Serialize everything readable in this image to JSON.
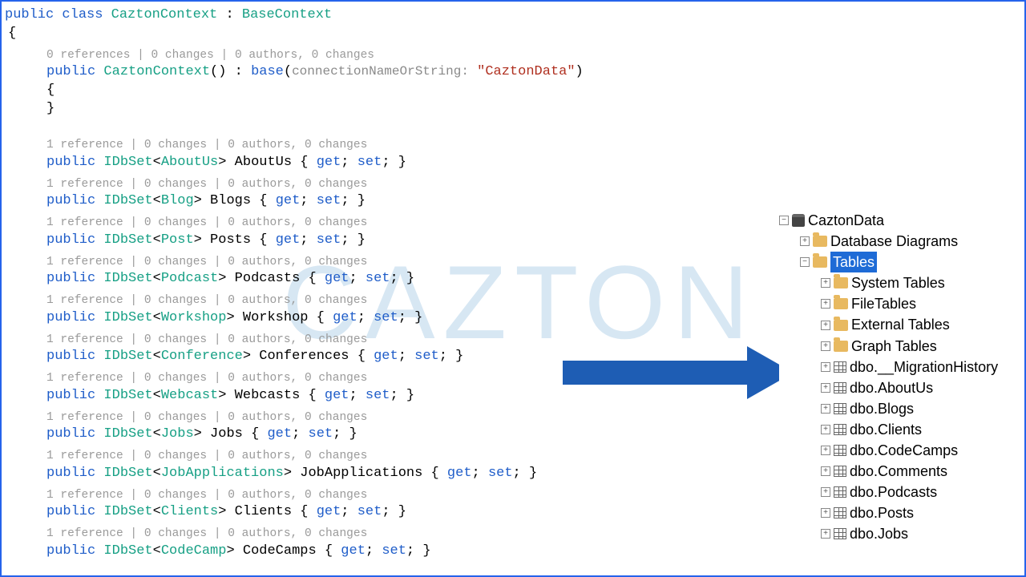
{
  "watermark": "CAZTON",
  "classDecl": {
    "kw1": "public",
    "kw2": "class",
    "name": "CaztonContext",
    "colon": ":",
    "base": "BaseContext"
  },
  "ctor": {
    "lens": "0 references | 0 changes | 0 authors, 0 changes",
    "kw": "public",
    "name": "CaztonContext",
    "parens": "()",
    "colon": ":",
    "baseKw": "base",
    "open": "(",
    "hint": "connectionNameOrString:",
    "str": "\"CaztonData\"",
    "close": ")",
    "braceOpen": "{",
    "braceClose": "}"
  },
  "openBrace": "{",
  "propLens": "1 reference | 0 changes | 0 authors, 0 changes",
  "props": [
    {
      "type": "AboutUs",
      "name": "AboutUs"
    },
    {
      "type": "Blog",
      "name": "Blogs"
    },
    {
      "type": "Post",
      "name": "Posts"
    },
    {
      "type": "Podcast",
      "name": "Podcasts"
    },
    {
      "type": "Workshop",
      "name": "Workshop"
    },
    {
      "type": "Conference",
      "name": "Conferences"
    },
    {
      "type": "Webcast",
      "name": "Webcasts"
    },
    {
      "type": "Jobs",
      "name": "Jobs"
    },
    {
      "type": "JobApplications",
      "name": "JobApplications"
    },
    {
      "type": "Clients",
      "name": "Clients"
    },
    {
      "type": "CodeCamp",
      "name": "CodeCamps"
    }
  ],
  "kw_public": "public",
  "kw_idbset": "IDbSet",
  "kw_get": "get",
  "kw_set": "set",
  "tree": {
    "db": "CaztonData",
    "folders": [
      "Database Diagrams"
    ],
    "tablesLabel": "Tables",
    "subfolders": [
      "System Tables",
      "FileTables",
      "External Tables",
      "Graph Tables"
    ],
    "tables": [
      "dbo.__MigrationHistory",
      "dbo.AboutUs",
      "dbo.Blogs",
      "dbo.Clients",
      "dbo.CodeCamps",
      "dbo.Comments",
      "dbo.Podcasts",
      "dbo.Posts",
      "dbo.Jobs"
    ],
    "minus": "−",
    "plus": "+"
  }
}
